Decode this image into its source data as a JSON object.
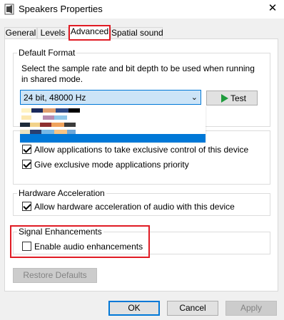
{
  "window": {
    "title": "Speakers Properties",
    "close_glyph": "✕"
  },
  "tabs": [
    {
      "label": "General"
    },
    {
      "label": "Levels"
    },
    {
      "label": "Advanced"
    },
    {
      "label": "Spatial sound"
    }
  ],
  "default_format": {
    "legend": "Default Format",
    "description": "Select the sample rate and bit depth to be used when running in shared mode.",
    "selected_value": "24 bit, 48000 Hz",
    "test_label": "Test"
  },
  "exclusive_mode": {
    "allow_exclusive": "Allow applications to take exclusive control of this device",
    "give_priority": "Give exclusive mode applications priority"
  },
  "hardware_acceleration": {
    "legend": "Hardware Acceleration",
    "allow_label": "Allow hardware acceleration of audio with this device"
  },
  "signal_enhancements": {
    "legend": "Signal Enhancements",
    "enable_label": "Enable audio enhancements"
  },
  "restore_defaults_label": "Restore Defaults",
  "footer": {
    "ok": "OK",
    "cancel": "Cancel",
    "apply": "Apply"
  },
  "colors": {
    "accent": "#0078d7",
    "highlight_red": "#e01b24",
    "play_green": "#1e9b3c",
    "selection_blue": "#cce4f7"
  },
  "icons": {
    "title": "speaker-properties-icon",
    "play": "play-icon",
    "chevron": "chevron-down-icon",
    "close": "close-icon"
  }
}
